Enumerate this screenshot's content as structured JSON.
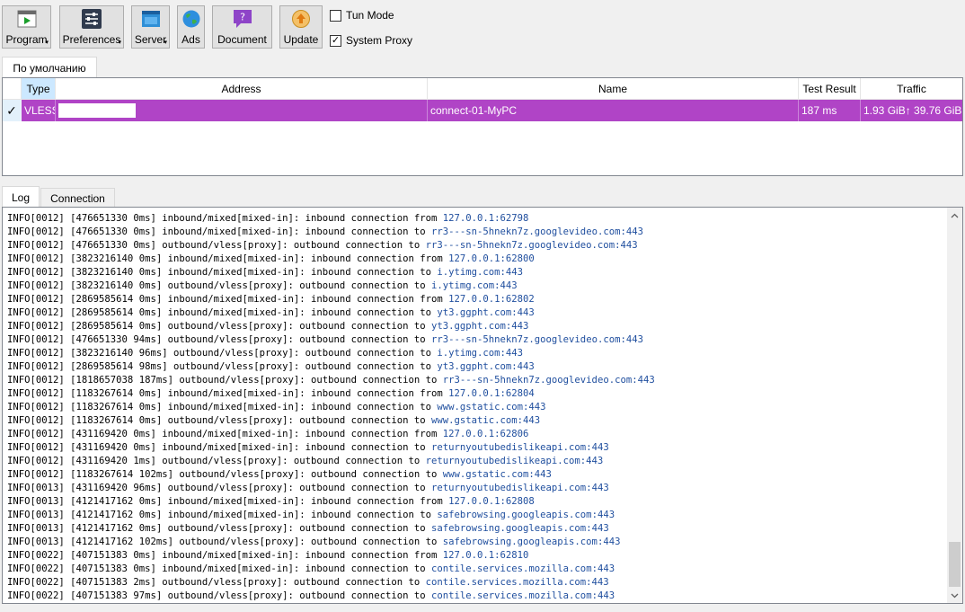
{
  "toolbar": {
    "buttons": [
      {
        "label": "Program",
        "icon": "program-icon",
        "has_menu": true
      },
      {
        "label": "Preferences",
        "icon": "preferences-icon",
        "has_menu": true
      },
      {
        "label": "Server",
        "icon": "server-icon",
        "has_menu": true
      },
      {
        "label": "Ads",
        "icon": "globe-icon",
        "has_menu": false
      },
      {
        "label": "Document",
        "icon": "help-icon",
        "has_menu": false
      },
      {
        "label": "Update",
        "icon": "update-icon",
        "has_menu": false
      }
    ],
    "menu_arrow": "▾",
    "tun_mode": {
      "label": "Tun Mode",
      "checked": false
    },
    "system_proxy": {
      "label": "System Proxy",
      "checked": true,
      "mark": "✓"
    }
  },
  "group_tab": {
    "label": "По умолчанию"
  },
  "servers": {
    "columns": [
      "Type",
      "Address",
      "Name",
      "Test Result",
      "Traffic"
    ],
    "rows": [
      {
        "selected_mark": "✓",
        "type": "VLESS",
        "address": "",
        "name": "connect-01-MyPC",
        "test_result": "187 ms",
        "traffic": "1.93 GiB↑ 39.76 GiB↓"
      }
    ]
  },
  "bottom_tabs": {
    "log": "Log",
    "connection": "Connection"
  },
  "log": {
    "lines": [
      {
        "prefix": "INFO[0012] [476651330 0ms] inbound/mixed[mixed-in]: inbound connection from ",
        "dest": "127.0.0.1:62798"
      },
      {
        "prefix": "INFO[0012] [476651330 0ms] inbound/mixed[mixed-in]: inbound connection to ",
        "dest": "rr3---sn-5hnekn7z.googlevideo.com:443"
      },
      {
        "prefix": "INFO[0012] [476651330 0ms] outbound/vless[proxy]: outbound connection to ",
        "dest": "rr3---sn-5hnekn7z.googlevideo.com:443"
      },
      {
        "prefix": "INFO[0012] [3823216140 0ms] inbound/mixed[mixed-in]: inbound connection from ",
        "dest": "127.0.0.1:62800"
      },
      {
        "prefix": "INFO[0012] [3823216140 0ms] inbound/mixed[mixed-in]: inbound connection to ",
        "dest": "i.ytimg.com:443"
      },
      {
        "prefix": "INFO[0012] [3823216140 0ms] outbound/vless[proxy]: outbound connection to ",
        "dest": "i.ytimg.com:443"
      },
      {
        "prefix": "INFO[0012] [2869585614 0ms] inbound/mixed[mixed-in]: inbound connection from ",
        "dest": "127.0.0.1:62802"
      },
      {
        "prefix": "INFO[0012] [2869585614 0ms] inbound/mixed[mixed-in]: inbound connection to ",
        "dest": "yt3.ggpht.com:443"
      },
      {
        "prefix": "INFO[0012] [2869585614 0ms] outbound/vless[proxy]: outbound connection to ",
        "dest": "yt3.ggpht.com:443"
      },
      {
        "prefix": "INFO[0012] [476651330 94ms] outbound/vless[proxy]: outbound connection to ",
        "dest": "rr3---sn-5hnekn7z.googlevideo.com:443"
      },
      {
        "prefix": "INFO[0012] [3823216140 96ms] outbound/vless[proxy]: outbound connection to ",
        "dest": "i.ytimg.com:443"
      },
      {
        "prefix": "INFO[0012] [2869585614 98ms] outbound/vless[proxy]: outbound connection to ",
        "dest": "yt3.ggpht.com:443"
      },
      {
        "prefix": "INFO[0012] [1818657038 187ms] outbound/vless[proxy]: outbound connection to ",
        "dest": "rr3---sn-5hnekn7z.googlevideo.com:443"
      },
      {
        "prefix": "INFO[0012] [1183267614 0ms] inbound/mixed[mixed-in]: inbound connection from ",
        "dest": "127.0.0.1:62804"
      },
      {
        "prefix": "INFO[0012] [1183267614 0ms] inbound/mixed[mixed-in]: inbound connection to ",
        "dest": "www.gstatic.com:443"
      },
      {
        "prefix": "INFO[0012] [1183267614 0ms] outbound/vless[proxy]: outbound connection to ",
        "dest": "www.gstatic.com:443"
      },
      {
        "prefix": "INFO[0012] [431169420 0ms] inbound/mixed[mixed-in]: inbound connection from ",
        "dest": "127.0.0.1:62806"
      },
      {
        "prefix": "INFO[0012] [431169420 0ms] inbound/mixed[mixed-in]: inbound connection to ",
        "dest": "returnyoutubedislikeapi.com:443"
      },
      {
        "prefix": "INFO[0012] [431169420 1ms] outbound/vless[proxy]: outbound connection to ",
        "dest": "returnyoutubedislikeapi.com:443"
      },
      {
        "prefix": "INFO[0012] [1183267614 102ms] outbound/vless[proxy]: outbound connection to ",
        "dest": "www.gstatic.com:443"
      },
      {
        "prefix": "INFO[0013] [431169420 96ms] outbound/vless[proxy]: outbound connection to ",
        "dest": "returnyoutubedislikeapi.com:443"
      },
      {
        "prefix": "INFO[0013] [4121417162 0ms] inbound/mixed[mixed-in]: inbound connection from ",
        "dest": "127.0.0.1:62808"
      },
      {
        "prefix": "INFO[0013] [4121417162 0ms] inbound/mixed[mixed-in]: inbound connection to ",
        "dest": "safebrowsing.googleapis.com:443"
      },
      {
        "prefix": "INFO[0013] [4121417162 0ms] outbound/vless[proxy]: outbound connection to ",
        "dest": "safebrowsing.googleapis.com:443"
      },
      {
        "prefix": "INFO[0013] [4121417162 102ms] outbound/vless[proxy]: outbound connection to ",
        "dest": "safebrowsing.googleapis.com:443"
      },
      {
        "prefix": "INFO[0022] [407151383 0ms] inbound/mixed[mixed-in]: inbound connection from ",
        "dest": "127.0.0.1:62810"
      },
      {
        "prefix": "INFO[0022] [407151383 0ms] inbound/mixed[mixed-in]: inbound connection to ",
        "dest": "contile.services.mozilla.com:443"
      },
      {
        "prefix": "INFO[0022] [407151383 2ms] outbound/vless[proxy]: outbound connection to ",
        "dest": "contile.services.mozilla.com:443"
      },
      {
        "prefix": "INFO[0022] [407151383 97ms] outbound/vless[proxy]: outbound connection to ",
        "dest": "contile.services.mozilla.com:443"
      }
    ]
  },
  "colors": {
    "selected_row": "#b044c6",
    "link_text": "#1f4e9e",
    "selected_header": "#cce8ff"
  }
}
